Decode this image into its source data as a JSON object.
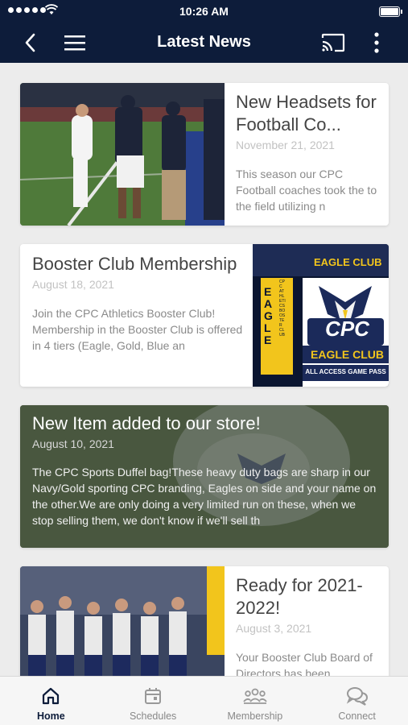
{
  "status_bar": {
    "time": "10:26 AM"
  },
  "nav": {
    "title": "Latest News"
  },
  "colors": {
    "navy": "#0d1c3a",
    "gold": "#f2c51c"
  },
  "articles": [
    {
      "title": "New Headsets for Football Co...",
      "date": "November 21, 2021",
      "excerpt": "This season our CPC Football coaches took the to the field utilizing n"
    },
    {
      "title": "Booster Club Membership",
      "date": "August 18, 2021",
      "excerpt": "Join the CPC Athletics Booster Club! Membership in the Booster Club is offered in 4 tiers (Eagle, Gold, Blue an",
      "image": {
        "header": "EAGLE CLUB",
        "side_word": "EAGLE",
        "side_text": "CPC ATHLETICS BOOSTER CLUB",
        "logo_text": "CPC",
        "club_text": "EAGLE CLUB",
        "pass_text": "ALL ACCESS GAME PASS"
      }
    },
    {
      "title": "New Item added to our store!",
      "date": "August 10, 2021",
      "excerpt": "The CPC Sports Duffel bag!These heavy duty bags are sharp in our Navy/Gold sporting CPC branding, Eagles on side and your name on the other.We are only doing a very limited run on these, when we stop selling them, we don't know if we'll sell th"
    },
    {
      "title": "Ready for 2021-2022!",
      "date": "August 3, 2021",
      "excerpt": "Your Booster Club Board of Directors has been"
    }
  ],
  "tabs": [
    {
      "label": "Home",
      "icon": "home-icon"
    },
    {
      "label": "Schedules",
      "icon": "calendar-icon"
    },
    {
      "label": "Membership",
      "icon": "group-icon"
    },
    {
      "label": "Connect",
      "icon": "chat-icon"
    }
  ]
}
